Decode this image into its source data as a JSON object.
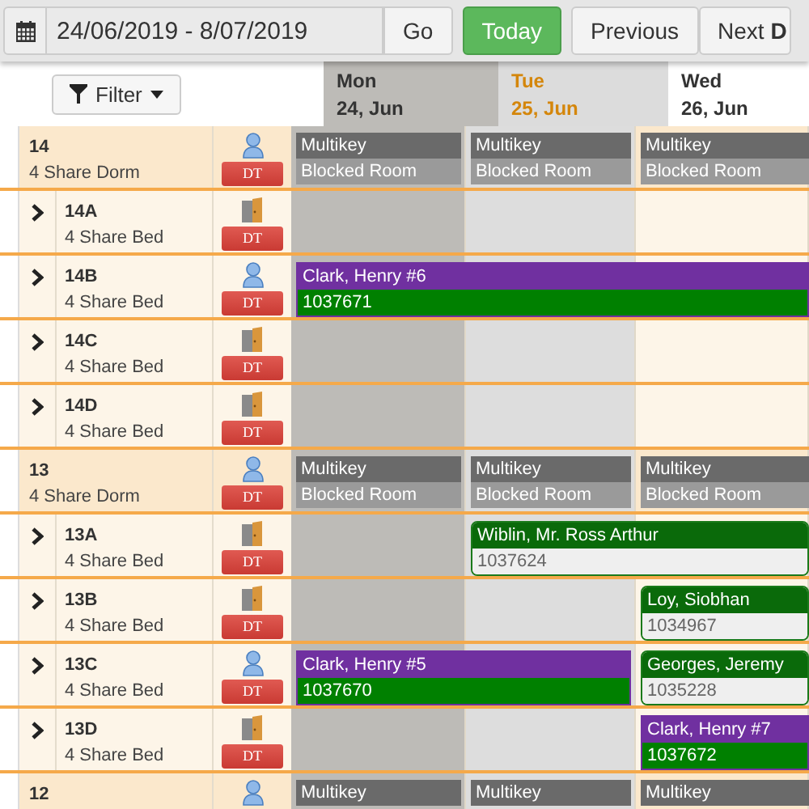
{
  "toolbar": {
    "date_range": "24/06/2019 - 8/07/2019",
    "buttons": [
      {
        "label": "Go",
        "kind": "plain"
      },
      {
        "label": "Today",
        "kind": "primary"
      },
      {
        "label": "Previous",
        "kind": "plain"
      },
      {
        "label": "Next **D**",
        "kind": "plain"
      }
    ]
  },
  "filter": {
    "label": "Filter"
  },
  "days": [
    {
      "weekday": "Mon",
      "date": "24, Jun",
      "past": true,
      "today": false
    },
    {
      "weekday": "Tue",
      "date": "25, Jun",
      "past": false,
      "today": true
    },
    {
      "weekday": "Wed",
      "date": "26, Jun",
      "past": false,
      "today": false
    }
  ],
  "rooms": [
    {
      "name": "14",
      "type": "4 Share Dorm",
      "occupied": true,
      "badge": "DT",
      "cells": [
        {
          "kind": "blocked",
          "title": "Multikey",
          "detail": "Blocked Room"
        },
        {
          "kind": "blocked",
          "title": "Multikey",
          "detail": "Blocked Room"
        },
        {
          "kind": "blocked",
          "title": "Multikey",
          "detail": "Blocked Room"
        }
      ],
      "beds": [
        {
          "name": "14A",
          "type": "4 Share Bed",
          "occupied": false,
          "badge": "DT",
          "cells": [
            {
              "kind": "empty"
            },
            {
              "kind": "empty"
            },
            {
              "kind": "empty"
            }
          ]
        },
        {
          "name": "14B",
          "type": "4 Share Bed",
          "occupied": true,
          "badge": "DT",
          "cells": [
            {
              "kind": "group",
              "title": "Clark, Henry #6",
              "detail": "1037671"
            },
            {
              "kind": "continued"
            },
            {
              "kind": "continued"
            }
          ]
        },
        {
          "name": "14C",
          "type": "4 Share Bed",
          "occupied": false,
          "badge": "DT",
          "cells": [
            {
              "kind": "empty"
            },
            {
              "kind": "empty"
            },
            {
              "kind": "empty"
            }
          ]
        },
        {
          "name": "14D",
          "type": "4 Share Bed",
          "occupied": false,
          "badge": "DT",
          "cells": [
            {
              "kind": "empty"
            },
            {
              "kind": "empty"
            },
            {
              "kind": "empty"
            }
          ]
        }
      ]
    },
    {
      "name": "13",
      "type": "4 Share Dorm",
      "occupied": true,
      "badge": "DT",
      "cells": [
        {
          "kind": "blocked",
          "title": "Multikey",
          "detail": "Blocked Room"
        },
        {
          "kind": "blocked",
          "title": "Multikey",
          "detail": "Blocked Room"
        },
        {
          "kind": "blocked",
          "title": "Multikey",
          "detail": "Blocked Room"
        }
      ],
      "beds": [
        {
          "name": "13A",
          "type": "4 Share Bed",
          "occupied": false,
          "badge": "DT",
          "cells": [
            {
              "kind": "empty"
            },
            {
              "kind": "guest",
              "title": "Wiblin, Mr. Ross Arthur",
              "detail": "1037624"
            },
            {
              "kind": "continued"
            }
          ]
        },
        {
          "name": "13B",
          "type": "4 Share Bed",
          "occupied": false,
          "badge": "DT",
          "cells": [
            {
              "kind": "empty"
            },
            {
              "kind": "empty"
            },
            {
              "kind": "guest",
              "title": "Loy, Siobhan",
              "detail": "1034967"
            }
          ]
        },
        {
          "name": "13C",
          "type": "4 Share Bed",
          "occupied": true,
          "badge": "DT",
          "cells": [
            {
              "kind": "group",
              "title": "Clark, Henry #5",
              "detail": "1037670"
            },
            {
              "kind": "continued"
            },
            {
              "kind": "guest",
              "title": "Georges, Jeremy",
              "detail": "1035228"
            }
          ]
        },
        {
          "name": "13D",
          "type": "4 Share Bed",
          "occupied": false,
          "badge": "DT",
          "cells": [
            {
              "kind": "empty"
            },
            {
              "kind": "empty"
            },
            {
              "kind": "group",
              "title": "Clark, Henry #7",
              "detail": "1037672"
            }
          ]
        }
      ]
    },
    {
      "name": "12",
      "occupied": true,
      "cells": [
        {
          "kind": "blocked",
          "title": "Multikey"
        },
        {
          "kind": "blocked",
          "title": "Multikey"
        },
        {
          "kind": "blocked",
          "title": "Multikey"
        }
      ]
    }
  ]
}
